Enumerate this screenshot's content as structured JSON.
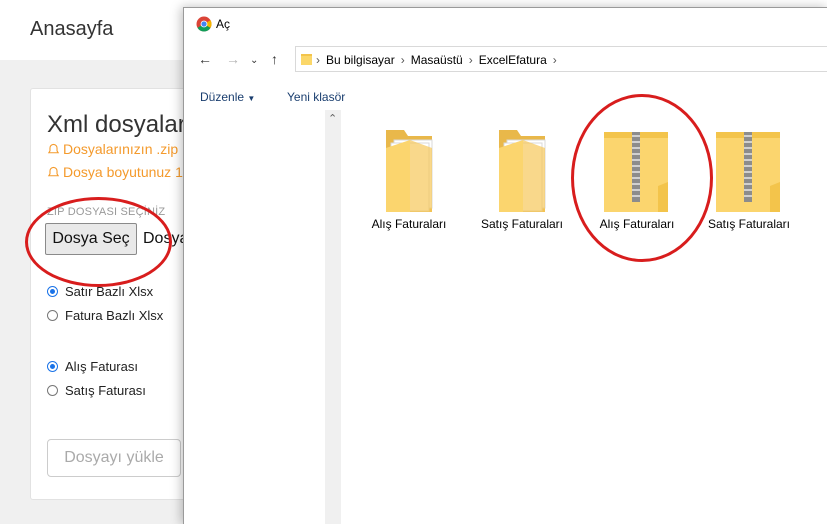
{
  "page": {
    "title": "Anasayfa",
    "card_title": "Xml dosyaların",
    "warnings": [
      "Dosyalarınızın .zip",
      "Dosya boyutunuz 1"
    ],
    "zip_label": "ZIP DOSYASI SEÇİNİZ",
    "file_button": "Dosya Seç",
    "file_status": "Dosya",
    "format_options": [
      {
        "label": "Satır Bazlı Xlsx",
        "selected": true
      },
      {
        "label": "Fatura Bazlı Xlsx",
        "selected": false
      }
    ],
    "type_options": [
      {
        "label": "Alış Faturası",
        "selected": true
      },
      {
        "label": "Satış Faturası",
        "selected": false
      }
    ],
    "upload_button": "Dosyayı yükle",
    "warning_color": "#f49a2c",
    "radio_color": "#1a73e8"
  },
  "dialog": {
    "title": "Aç",
    "app_icon": "chrome-icon",
    "breadcrumbs": [
      "Bu bilgisayar",
      "Masaüstü",
      "ExcelEfatura"
    ],
    "commands": {
      "organize": "Düzenle",
      "new_folder": "Yeni klasör"
    },
    "items": [
      {
        "name": "Alış Faturaları",
        "icon": "folder-icon"
      },
      {
        "name": "Satış Faturaları",
        "icon": "folder-icon"
      },
      {
        "name": "Alış Faturaları",
        "icon": "zip-folder-icon"
      },
      {
        "name": "Satış Faturaları",
        "icon": "zip-folder-icon"
      }
    ]
  },
  "annotation_color": "#d81d1d"
}
